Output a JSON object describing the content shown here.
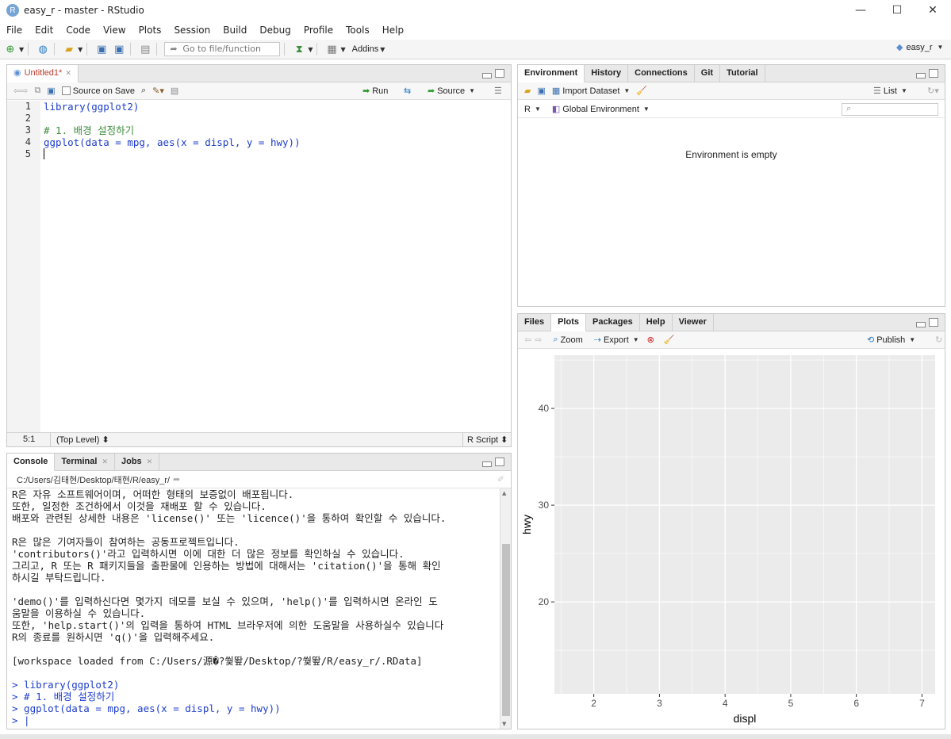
{
  "window": {
    "title": "easy_r - master - RStudio",
    "logo": "R",
    "min": "—",
    "max": "☐",
    "close": "✕"
  },
  "menu": [
    "File",
    "Edit",
    "Code",
    "View",
    "Plots",
    "Session",
    "Build",
    "Debug",
    "Profile",
    "Tools",
    "Help"
  ],
  "toolbar": {
    "goto_placeholder": "Go to file/function",
    "addins": "Addins",
    "project": "easy_r"
  },
  "editor": {
    "tab": "Untitled1*",
    "source_on_save": "Source on Save",
    "run": "Run",
    "source": "Source",
    "lines": [
      "library(ggplot2)",
      "",
      "# 1. 배경 설정하기",
      "ggplot(data = mpg, aes(x = displ, y = hwy))",
      ""
    ],
    "line_numbers": [
      "1",
      "2",
      "3",
      "4",
      "5"
    ],
    "status_pos": "5:1",
    "status_scope": "(Top Level) ⬍",
    "status_type": "R Script ⬍"
  },
  "console": {
    "tabs": [
      "Console",
      "Terminal",
      "Jobs"
    ],
    "path": "C:/Users/김태현/Desktop/태현/R/easy_r/",
    "lines": [
      "R은 자유 소프트웨어이며, 어떠한 형태의 보증없이 배포됩니다.",
      "또한, 일정한 조건하에서 이것을 재배포 할 수 있습니다.",
      "배포와 관련된 상세한 내용은 'license()' 또는 'licence()'을 통하여 확인할 수 있습니다.",
      "",
      "R은 많은 기여자들이 참여하는 공동프로젝트입니다.",
      "'contributors()'라고 입력하시면 이에 대한 더 많은 정보를 확인하실 수 있습니다.",
      "그리고, R 또는 R 패키지들을 출판물에 인용하는 방법에 대해서는 'citation()'을 통해 확인",
      "하시길 부탁드립니다.",
      "",
      "'demo()'를 입력하신다면 몇가지 데모를 보실 수 있으며, 'help()'를 입력하시면 온라인 도",
      "움말을 이용하실 수 있습니다.",
      "또한, 'help.start()'의 입력을 통하여 HTML 브라우저에 의한 도움말을 사용하실수 있습니다",
      "R의 종료를 원하시면 'q()'을 입력해주세요.",
      "",
      "[workspace loaded from C:/Users/源�?쒗뙆/Desktop/?쒗뙆/R/easy_r/.RData]",
      ""
    ],
    "commands": [
      "> library(ggplot2)",
      "> # 1. 배경 설정하기",
      "> ggplot(data = mpg, aes(x = displ, y = hwy))",
      "> |"
    ]
  },
  "environment": {
    "tabs": [
      "Environment",
      "History",
      "Connections",
      "Git",
      "Tutorial"
    ],
    "import_dataset": "Import Dataset",
    "list": "List",
    "lang": "R",
    "scope": "Global Environment",
    "empty": "Environment is empty"
  },
  "files": {
    "tabs": [
      "Files",
      "Plots",
      "Packages",
      "Help",
      "Viewer"
    ],
    "zoom": "Zoom",
    "export": "Export",
    "publish": "Publish"
  },
  "chart_data": {
    "type": "scatter",
    "xlabel": "displ",
    "ylabel": "hwy",
    "xlim": [
      1.4,
      7.2
    ],
    "ylim": [
      10.5,
      45.5
    ],
    "x_ticks": [
      2,
      3,
      4,
      5,
      6,
      7
    ],
    "y_ticks": [
      20,
      30,
      40
    ],
    "x": [],
    "y": [],
    "background": "#ebebeb",
    "grid": true
  }
}
